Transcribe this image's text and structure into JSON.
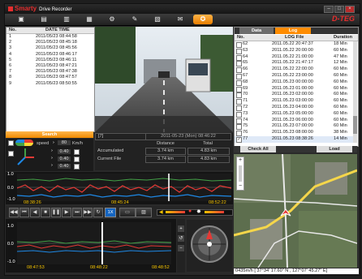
{
  "window": {
    "brand": "Smarty",
    "subtitle": "Drive Recorder",
    "logo": "D-TEG",
    "controls": [
      "–",
      "□",
      "×"
    ]
  },
  "toolbar": {
    "buttons": [
      {
        "name": "open-folder-icon"
      },
      {
        "name": "save-icon"
      },
      {
        "name": "print-icon"
      },
      {
        "name": "print-preview-icon"
      },
      {
        "name": "settings-icon"
      },
      {
        "name": "tools-icon"
      },
      {
        "name": "export-icon"
      },
      {
        "name": "message-icon"
      },
      {
        "name": "help-icon"
      }
    ]
  },
  "file_list": {
    "columns": [
      "No.",
      "DATE TIME"
    ],
    "rows": [
      {
        "no": "1",
        "dt": "2011/05/23 08:44:58"
      },
      {
        "no": "2",
        "dt": "2011/05/23 08:45:18"
      },
      {
        "no": "3",
        "dt": "2011/05/23 08:45:56"
      },
      {
        "no": "4",
        "dt": "2011/05/23 08:46:17"
      },
      {
        "no": "5",
        "dt": "2011/05/23 08:46:11"
      },
      {
        "no": "6",
        "dt": "2011/05/23 08:47:21"
      },
      {
        "no": "7",
        "dt": "2011/05/23 08:47:38"
      },
      {
        "no": "8",
        "dt": "2011/05/23 08:47:57"
      },
      {
        "no": "9",
        "dt": "2011/05/23 08:50:55"
      }
    ],
    "search_label": "Search"
  },
  "sensor": {
    "speed_label": "speed",
    "speed_value": "80",
    "speed_unit": "Km/h",
    "axes": [
      {
        "label": "X",
        "value": "0.40",
        "color": "#e53935"
      },
      {
        "label": "Y",
        "value": "0.40",
        "color": "#43a047"
      },
      {
        "label": "Z",
        "value": "0.40",
        "color": "#1e88e5"
      }
    ]
  },
  "info": {
    "record": "[7]",
    "timestamp": "2011-05-23 (Mon) 08:46:22",
    "headers": [
      "Distance",
      "Total"
    ],
    "rows": [
      {
        "label": "Accumulated",
        "distance": "3.74 km",
        "total": "4.83 km"
      },
      {
        "label": "Current File",
        "distance": "3.74 km",
        "total": "4.83 km"
      }
    ]
  },
  "log": {
    "tabs": [
      "Data",
      "Log"
    ],
    "columns": [
      "No.",
      "LOG File",
      "Duration"
    ],
    "rows": [
      {
        "no": "62",
        "file": "2011.05.22 20:47:37",
        "dur": "18 Min",
        "checked": false
      },
      {
        "no": "63",
        "file": "2011.05.22 20:00:00",
        "dur": "60 Min",
        "checked": false
      },
      {
        "no": "64",
        "file": "2011.05.22 21:00:00",
        "dur": "47 Min",
        "checked": false
      },
      {
        "no": "65",
        "file": "2011.05.22 21:47:17",
        "dur": "12 Min",
        "checked": false
      },
      {
        "no": "66",
        "file": "2011.05.22 22:00:00",
        "dur": "60 Min",
        "checked": false
      },
      {
        "no": "67",
        "file": "2011.05.22 23:00:00",
        "dur": "60 Min",
        "checked": false
      },
      {
        "no": "68",
        "file": "2011.05.23 00:00:00",
        "dur": "60 Min",
        "checked": false
      },
      {
        "no": "69",
        "file": "2011.05.23 01:00:00",
        "dur": "60 Min",
        "checked": false
      },
      {
        "no": "70",
        "file": "2011.05.23 02:00:00",
        "dur": "60 Min",
        "checked": false
      },
      {
        "no": "71",
        "file": "2011.05.23 03:00:00",
        "dur": "60 Min",
        "checked": false
      },
      {
        "no": "72",
        "file": "2011.05.23 04:00:00",
        "dur": "60 Min",
        "checked": false
      },
      {
        "no": "73",
        "file": "2011.05.23 05:00:00",
        "dur": "60 Min",
        "checked": false
      },
      {
        "no": "74",
        "file": "2011.05.23 06:00:00",
        "dur": "60 Min",
        "checked": false
      },
      {
        "no": "75",
        "file": "2011.05.23 07:00:00",
        "dur": "60 Min",
        "checked": false
      },
      {
        "no": "76",
        "file": "2011.05.23 08:00:00",
        "dur": "38 Min",
        "checked": false
      },
      {
        "no": "77",
        "file": "2011.05.23 08:38:26",
        "dur": "14 Min",
        "checked": true
      }
    ],
    "check_all": "Check All",
    "load": "Load"
  },
  "graph_top": {
    "ymax": "1.0",
    "ymid": "0.0",
    "ymin": "-1.0",
    "times": [
      "08:38:26",
      "08:45:24",
      "08:52:22"
    ]
  },
  "graph_bottom": {
    "ymax": "1.0",
    "ymid": "0.0",
    "ymin": "-1.0",
    "times": [
      "08:47:53",
      "08:48:22",
      "08:48:52"
    ]
  },
  "playback": {
    "speed": "1X",
    "buttons": [
      "play-icon",
      "prev-icon",
      "step-back-icon",
      "stop-icon",
      "pause-icon",
      "step-forward-icon",
      "next-icon",
      "repeat-icon"
    ]
  },
  "map": {
    "status": "0435m/h  [ 37°34' 17.60\" N , 127°07' 45.27\" E]"
  }
}
